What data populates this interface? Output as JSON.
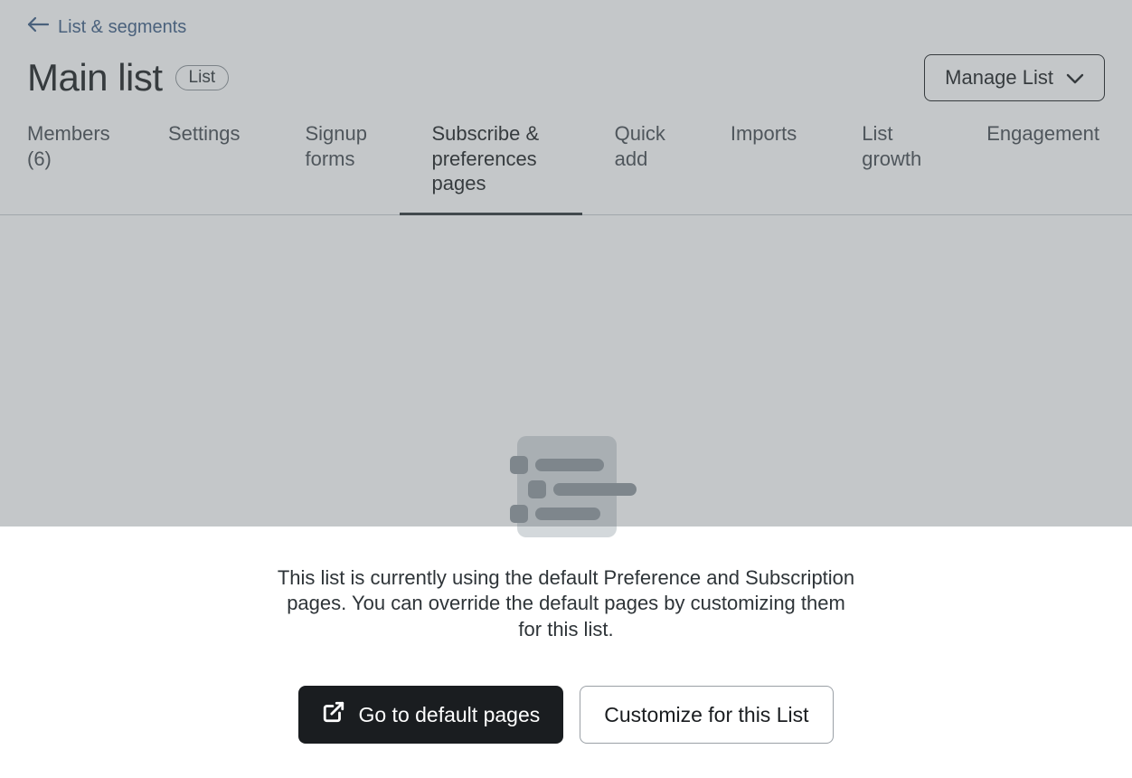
{
  "breadcrumb": {
    "label": "List & segments"
  },
  "title": {
    "text": "Main list",
    "badge": "List"
  },
  "manage": {
    "label": "Manage List"
  },
  "tabs": {
    "members": "Members (6)",
    "settings": "Settings",
    "signup": "Signup forms",
    "subscribe": "Subscribe & preferences pages",
    "quick": "Quick add",
    "imports": "Imports",
    "growth": "List growth",
    "engagement": "Engagement"
  },
  "message": "This list is currently using the default Preference and Subscription pages. You can override the default pages by customizing them for this list.",
  "buttons": {
    "go_default": "Go to default pages",
    "customize": "Customize for this List"
  }
}
